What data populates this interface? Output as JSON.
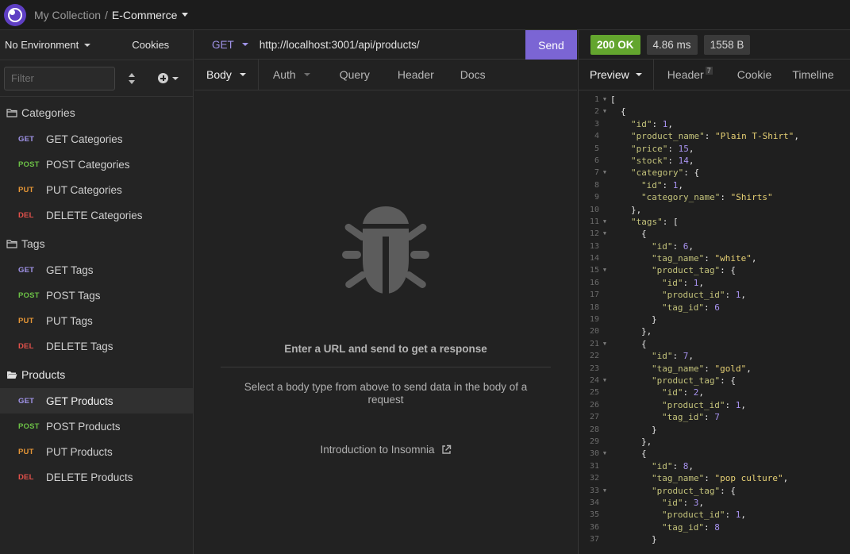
{
  "topbar": {
    "collection": "My Collection",
    "separator": "/",
    "project": "E-Commerce"
  },
  "sidebar": {
    "environment": "No Environment",
    "cookies": "Cookies",
    "filter_placeholder": "Filter",
    "folders": [
      {
        "name": "Categories",
        "open": false,
        "items": [
          {
            "method": "GET",
            "label": "GET Categories"
          },
          {
            "method": "POST",
            "label": "POST Categories"
          },
          {
            "method": "PUT",
            "label": "PUT Categories"
          },
          {
            "method": "DEL",
            "label": "DELETE Categories"
          }
        ]
      },
      {
        "name": "Tags",
        "open": false,
        "items": [
          {
            "method": "GET",
            "label": "GET Tags"
          },
          {
            "method": "POST",
            "label": "POST Tags"
          },
          {
            "method": "PUT",
            "label": "PUT Tags"
          },
          {
            "method": "DEL",
            "label": "DELETE Tags"
          }
        ]
      },
      {
        "name": "Products",
        "open": true,
        "items": [
          {
            "method": "GET",
            "label": "GET Products",
            "active": true
          },
          {
            "method": "POST",
            "label": "POST Products"
          },
          {
            "method": "PUT",
            "label": "PUT Products"
          },
          {
            "method": "DEL",
            "label": "DELETE Products"
          }
        ]
      }
    ]
  },
  "request": {
    "method": "GET",
    "url": "http://localhost:3001/api/products/",
    "send_label": "Send",
    "tabs": [
      "Body",
      "Auth",
      "Query",
      "Header",
      "Docs"
    ],
    "empty_title": "Enter a URL and send to get a response",
    "empty_desc": "Select a body type from above to send data in the body of a request",
    "intro_link": "Introduction to Insomnia"
  },
  "response": {
    "status": "200 OK",
    "time": "4.86 ms",
    "size": "1558 B",
    "tabs": [
      {
        "label": "Preview"
      },
      {
        "label": "Header",
        "badge": "7"
      },
      {
        "label": "Cookie"
      },
      {
        "label": "Timeline"
      }
    ],
    "lines": [
      {
        "n": "1",
        "fold": true,
        "indent": 0,
        "tokens": [
          [
            "p",
            "["
          ]
        ]
      },
      {
        "n": "2",
        "fold": true,
        "indent": 1,
        "tokens": [
          [
            "p",
            "{"
          ]
        ]
      },
      {
        "n": "3",
        "indent": 2,
        "tokens": [
          [
            "k",
            "\"id\""
          ],
          [
            "p",
            ": "
          ],
          [
            "n",
            "1"
          ],
          [
            "p",
            ","
          ]
        ]
      },
      {
        "n": "4",
        "indent": 2,
        "tokens": [
          [
            "k",
            "\"product_name\""
          ],
          [
            "p",
            ": "
          ],
          [
            "s",
            "\"Plain T-Shirt\""
          ],
          [
            "p",
            ","
          ]
        ]
      },
      {
        "n": "5",
        "indent": 2,
        "tokens": [
          [
            "k",
            "\"price\""
          ],
          [
            "p",
            ": "
          ],
          [
            "n",
            "15"
          ],
          [
            "p",
            ","
          ]
        ]
      },
      {
        "n": "6",
        "indent": 2,
        "tokens": [
          [
            "k",
            "\"stock\""
          ],
          [
            "p",
            ": "
          ],
          [
            "n",
            "14"
          ],
          [
            "p",
            ","
          ]
        ]
      },
      {
        "n": "7",
        "fold": true,
        "indent": 2,
        "tokens": [
          [
            "k",
            "\"category\""
          ],
          [
            "p",
            ": {"
          ]
        ]
      },
      {
        "n": "8",
        "indent": 3,
        "tokens": [
          [
            "k",
            "\"id\""
          ],
          [
            "p",
            ": "
          ],
          [
            "n",
            "1"
          ],
          [
            "p",
            ","
          ]
        ]
      },
      {
        "n": "9",
        "indent": 3,
        "tokens": [
          [
            "k",
            "\"category_name\""
          ],
          [
            "p",
            ": "
          ],
          [
            "s",
            "\"Shirts\""
          ]
        ]
      },
      {
        "n": "10",
        "indent": 2,
        "tokens": [
          [
            "p",
            "},"
          ]
        ]
      },
      {
        "n": "11",
        "fold": true,
        "indent": 2,
        "tokens": [
          [
            "k",
            "\"tags\""
          ],
          [
            "p",
            ": ["
          ]
        ]
      },
      {
        "n": "12",
        "fold": true,
        "indent": 3,
        "tokens": [
          [
            "p",
            "{"
          ]
        ]
      },
      {
        "n": "13",
        "indent": 4,
        "tokens": [
          [
            "k",
            "\"id\""
          ],
          [
            "p",
            ": "
          ],
          [
            "n",
            "6"
          ],
          [
            "p",
            ","
          ]
        ]
      },
      {
        "n": "14",
        "indent": 4,
        "tokens": [
          [
            "k",
            "\"tag_name\""
          ],
          [
            "p",
            ": "
          ],
          [
            "s",
            "\"white\""
          ],
          [
            "p",
            ","
          ]
        ]
      },
      {
        "n": "15",
        "fold": true,
        "indent": 4,
        "tokens": [
          [
            "k",
            "\"product_tag\""
          ],
          [
            "p",
            ": {"
          ]
        ]
      },
      {
        "n": "16",
        "indent": 5,
        "tokens": [
          [
            "k",
            "\"id\""
          ],
          [
            "p",
            ": "
          ],
          [
            "n",
            "1"
          ],
          [
            "p",
            ","
          ]
        ]
      },
      {
        "n": "17",
        "indent": 5,
        "tokens": [
          [
            "k",
            "\"product_id\""
          ],
          [
            "p",
            ": "
          ],
          [
            "n",
            "1"
          ],
          [
            "p",
            ","
          ]
        ]
      },
      {
        "n": "18",
        "indent": 5,
        "tokens": [
          [
            "k",
            "\"tag_id\""
          ],
          [
            "p",
            ": "
          ],
          [
            "n",
            "6"
          ]
        ]
      },
      {
        "n": "19",
        "indent": 4,
        "tokens": [
          [
            "p",
            "}"
          ]
        ]
      },
      {
        "n": "20",
        "indent": 3,
        "tokens": [
          [
            "p",
            "},"
          ]
        ]
      },
      {
        "n": "21",
        "fold": true,
        "indent": 3,
        "tokens": [
          [
            "p",
            "{"
          ]
        ]
      },
      {
        "n": "22",
        "indent": 4,
        "tokens": [
          [
            "k",
            "\"id\""
          ],
          [
            "p",
            ": "
          ],
          [
            "n",
            "7"
          ],
          [
            "p",
            ","
          ]
        ]
      },
      {
        "n": "23",
        "indent": 4,
        "tokens": [
          [
            "k",
            "\"tag_name\""
          ],
          [
            "p",
            ": "
          ],
          [
            "s",
            "\"gold\""
          ],
          [
            "p",
            ","
          ]
        ]
      },
      {
        "n": "24",
        "fold": true,
        "indent": 4,
        "tokens": [
          [
            "k",
            "\"product_tag\""
          ],
          [
            "p",
            ": {"
          ]
        ]
      },
      {
        "n": "25",
        "indent": 5,
        "tokens": [
          [
            "k",
            "\"id\""
          ],
          [
            "p",
            ": "
          ],
          [
            "n",
            "2"
          ],
          [
            "p",
            ","
          ]
        ]
      },
      {
        "n": "26",
        "indent": 5,
        "tokens": [
          [
            "k",
            "\"product_id\""
          ],
          [
            "p",
            ": "
          ],
          [
            "n",
            "1"
          ],
          [
            "p",
            ","
          ]
        ]
      },
      {
        "n": "27",
        "indent": 5,
        "tokens": [
          [
            "k",
            "\"tag_id\""
          ],
          [
            "p",
            ": "
          ],
          [
            "n",
            "7"
          ]
        ]
      },
      {
        "n": "28",
        "indent": 4,
        "tokens": [
          [
            "p",
            "}"
          ]
        ]
      },
      {
        "n": "29",
        "indent": 3,
        "tokens": [
          [
            "p",
            "},"
          ]
        ]
      },
      {
        "n": "30",
        "fold": true,
        "indent": 3,
        "tokens": [
          [
            "p",
            "{"
          ]
        ]
      },
      {
        "n": "31",
        "indent": 4,
        "tokens": [
          [
            "k",
            "\"id\""
          ],
          [
            "p",
            ": "
          ],
          [
            "n",
            "8"
          ],
          [
            "p",
            ","
          ]
        ]
      },
      {
        "n": "32",
        "indent": 4,
        "tokens": [
          [
            "k",
            "\"tag_name\""
          ],
          [
            "p",
            ": "
          ],
          [
            "s",
            "\"pop culture\""
          ],
          [
            "p",
            ","
          ]
        ]
      },
      {
        "n": "33",
        "fold": true,
        "indent": 4,
        "tokens": [
          [
            "k",
            "\"product_tag\""
          ],
          [
            "p",
            ": {"
          ]
        ]
      },
      {
        "n": "34",
        "indent": 5,
        "tokens": [
          [
            "k",
            "\"id\""
          ],
          [
            "p",
            ": "
          ],
          [
            "n",
            "3"
          ],
          [
            "p",
            ","
          ]
        ]
      },
      {
        "n": "35",
        "indent": 5,
        "tokens": [
          [
            "k",
            "\"product_id\""
          ],
          [
            "p",
            ": "
          ],
          [
            "n",
            "1"
          ],
          [
            "p",
            ","
          ]
        ]
      },
      {
        "n": "36",
        "indent": 5,
        "tokens": [
          [
            "k",
            "\"tag_id\""
          ],
          [
            "p",
            ": "
          ],
          [
            "n",
            "8"
          ]
        ]
      },
      {
        "n": "37",
        "indent": 4,
        "tokens": [
          [
            "p",
            "}"
          ]
        ]
      }
    ]
  },
  "colors": {
    "accent": "#7b65d4",
    "ok": "#63a52e",
    "get": "#a093e8",
    "post": "#6cc046",
    "put": "#e69636",
    "delete": "#e3514b"
  }
}
